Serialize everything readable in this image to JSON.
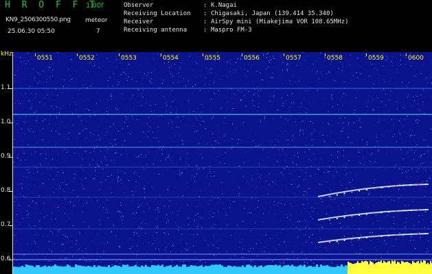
{
  "header": {
    "app_title": "H R O F F T",
    "version": "1.00f",
    "filename": "KN9_2506300550.png",
    "mode": "meteor",
    "datetime": "25.06.30 05:50",
    "mode_value": "7",
    "info": [
      {
        "label": "Observer",
        "value": "K.Nagai"
      },
      {
        "label": "Receiving Location",
        "value": "Chigasaki, Japan (139.414 35.340)"
      },
      {
        "label": "Receiver",
        "value": "AirSpy mini (Miakejima VOR 108.65MHz)"
      },
      {
        "label": "Receiving antenna",
        "value": "Maspro FM-3"
      }
    ]
  },
  "chart_data": {
    "type": "heatmap",
    "y_unit": "kHz",
    "y_ticks": [
      "1.1",
      "1.0",
      "0.9",
      "0.8",
      "0.7",
      "0.6"
    ],
    "x_ticks": [
      "0551",
      "0552",
      "0553",
      "0554",
      "0555",
      "0556",
      "0557",
      "0558",
      "0559",
      "0600"
    ],
    "colors": {
      "background": "#0a128c",
      "noise_hi": "#4fa4ff",
      "line": "#55e6ff",
      "signal": "#ffff40"
    }
  }
}
